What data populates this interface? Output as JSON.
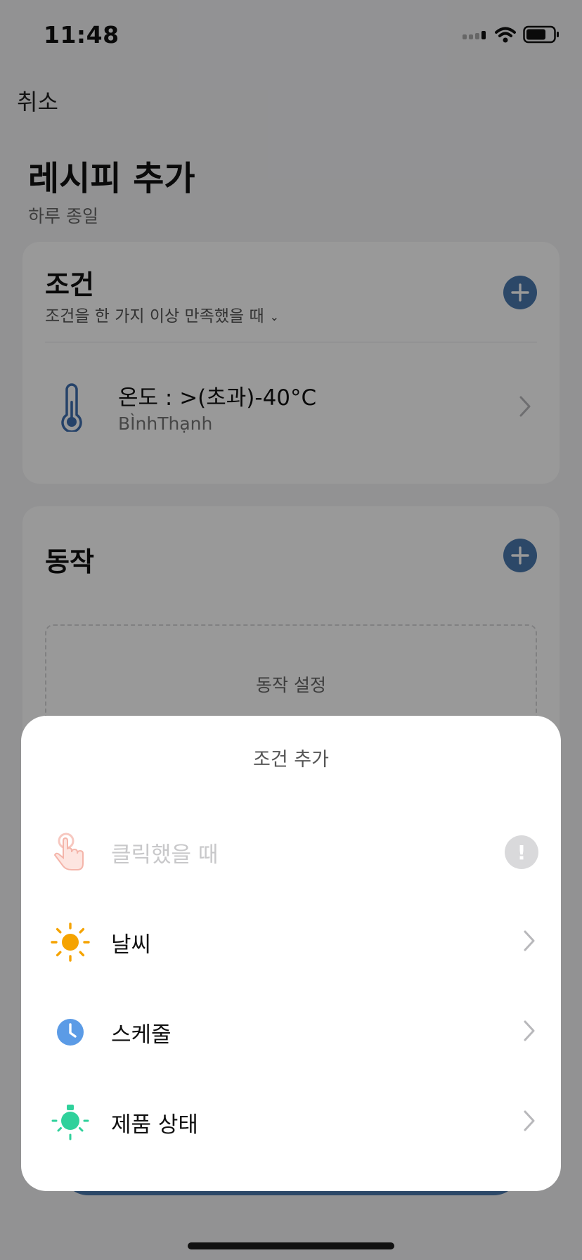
{
  "status_bar": {
    "time": "11:48"
  },
  "nav": {
    "cancel_label": "취소"
  },
  "page": {
    "title": "레시피 추가",
    "subtitle": "하루 종일"
  },
  "conditions": {
    "title": "조건",
    "match_hint": "조건을 한 가지 이상 만족했을 때",
    "items": [
      {
        "label": "온도 : >(초과)-40°C",
        "location": "BÌnhThạnh",
        "icon": "thermometer-icon"
      }
    ]
  },
  "actions": {
    "title": "동작",
    "placeholder": "동작 설정"
  },
  "sheet": {
    "title": "조건 추가",
    "options": [
      {
        "label": "클릭했을 때",
        "icon": "tap-hand-icon",
        "disabled": true,
        "badge": "!"
      },
      {
        "label": "날씨",
        "icon": "sun-icon"
      },
      {
        "label": "스케줄",
        "icon": "clock-icon"
      },
      {
        "label": "제품 상태",
        "icon": "bulb-icon"
      }
    ]
  },
  "colors": {
    "accent": "#4a78ad",
    "sun": "#f5a300",
    "clock": "#5b9be6",
    "bulb": "#2fd19b",
    "tap": "#f7c8c0"
  }
}
